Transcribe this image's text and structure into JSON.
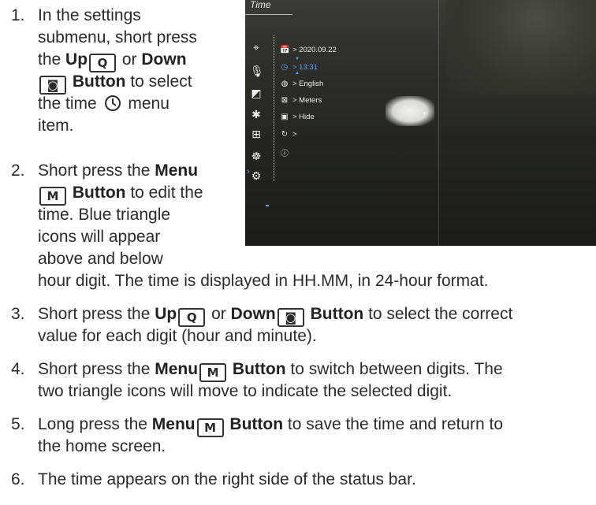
{
  "steps": [
    {
      "num": "1.",
      "lines": [
        [
          {
            "t": "In the settings"
          }
        ],
        [
          {
            "t": "submenu, short press"
          }
        ],
        [
          {
            "t": "the "
          },
          {
            "b": "Up"
          },
          {
            "k": "Q"
          },
          {
            "t": " or "
          },
          {
            "b": "Down"
          }
        ],
        [
          {
            "k": "◙"
          },
          {
            "b": " Button"
          },
          {
            "t": " to select"
          }
        ],
        [
          {
            "t": "the time "
          },
          {
            "c": "clock"
          },
          {
            "t": " menu"
          }
        ],
        [
          {
            "t": "item."
          }
        ]
      ]
    },
    {
      "num": "2.",
      "lines": [
        [
          {
            "t": "Short press the "
          },
          {
            "b": "Menu"
          }
        ],
        [
          {
            "k": "M"
          },
          {
            "b": " Button"
          },
          {
            "t": " to edit the"
          }
        ],
        [
          {
            "t": "time. Blue triangle"
          }
        ],
        [
          {
            "t": "icons will appear"
          }
        ],
        [
          {
            "t": "above and below"
          }
        ],
        [
          {
            "t": "hour digit. The time is displayed in HH.MM, in 24-hour format."
          }
        ]
      ]
    },
    {
      "num": "3.",
      "lines": [
        [
          {
            "t": "Short press the "
          },
          {
            "b": "Up"
          },
          {
            "k": "Q"
          },
          {
            "t": " or "
          },
          {
            "b": "Down"
          },
          {
            "k": "◙"
          },
          {
            "b": " Button"
          },
          {
            "t": " to select the correct"
          }
        ],
        [
          {
            "t": "value for each digit (hour and minute)."
          }
        ]
      ]
    },
    {
      "num": "4.",
      "lines": [
        [
          {
            "t": "Short press the "
          },
          {
            "b": "Menu"
          },
          {
            "k": "M"
          },
          {
            "b": " Button"
          },
          {
            "t": " to switch between digits. The"
          }
        ],
        [
          {
            "t": "two triangle icons will move to indicate the selected digit."
          }
        ]
      ]
    },
    {
      "num": "5.",
      "lines": [
        [
          {
            "t": "Long press the "
          },
          {
            "b": "Menu"
          },
          {
            "k": "M"
          },
          {
            "b": " Button"
          },
          {
            "t": " to save the time and return to"
          }
        ],
        [
          {
            "t": "the home screen."
          }
        ]
      ]
    },
    {
      "num": "6.",
      "lines": [
        [
          {
            "t": "The time appears on the right side of the status bar."
          }
        ]
      ]
    }
  ],
  "device": {
    "menu_title": "Time",
    "items": [
      {
        "icon": "📅",
        "label": "> 2020.09.22",
        "active": false
      },
      {
        "icon": "◷",
        "label": "> 13:31",
        "active": true
      },
      {
        "icon": "◍",
        "label": "> English",
        "active": false
      },
      {
        "icon": "⊠",
        "label": "> Meters",
        "active": false
      },
      {
        "icon": "▣",
        "label": "> Hide",
        "active": false
      },
      {
        "icon": "↻",
        "label": ">",
        "active": false
      },
      {
        "icon": "ⓘ",
        "label": "",
        "active": false
      }
    ],
    "side_icons": [
      "⌖",
      "🎙",
      "◩",
      "✱",
      "⊞",
      "☸",
      "⚙"
    ],
    "colors": {
      "accent": "#5aa0ff"
    }
  }
}
